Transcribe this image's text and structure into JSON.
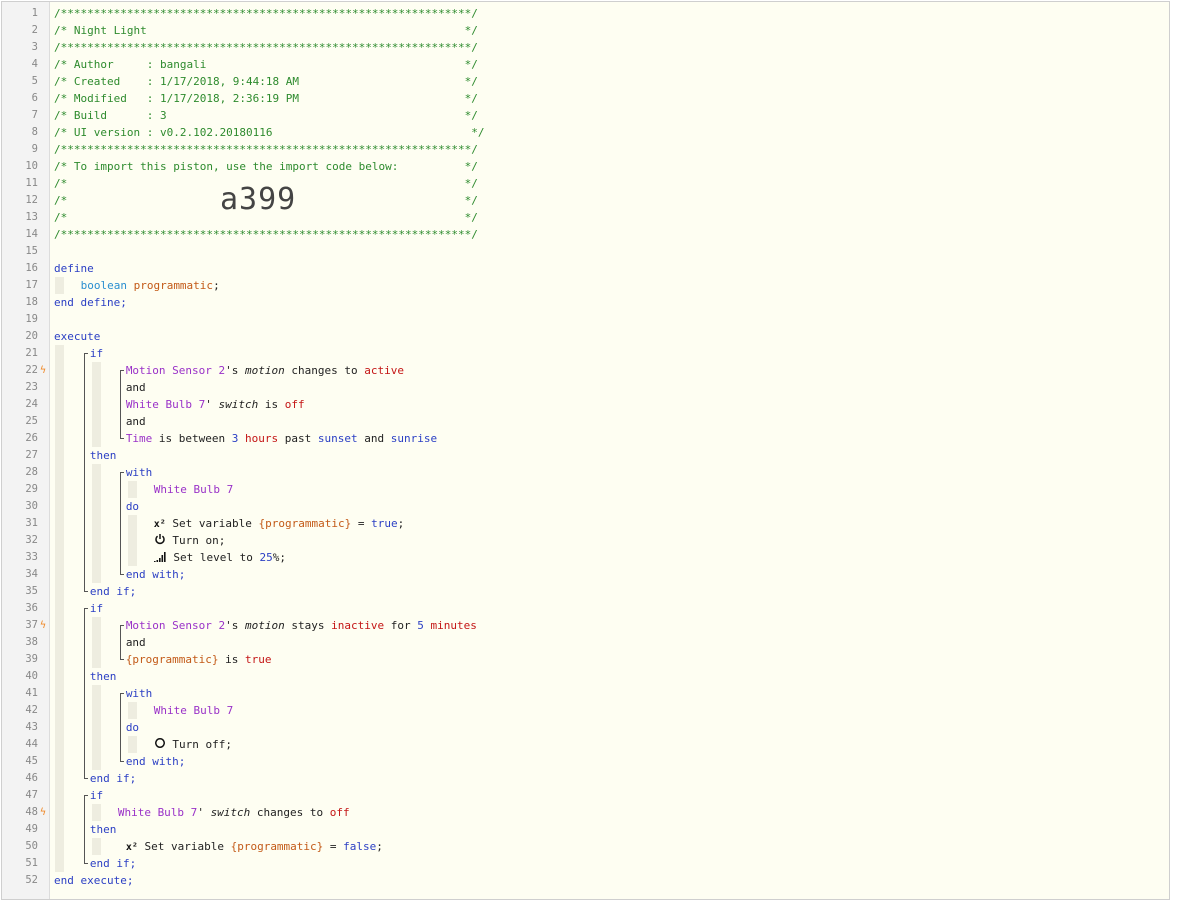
{
  "header": {
    "border": "/**************************************************************/",
    "title": "/* Night Light                                                */",
    "author": "/* Author     : bangali                                       */",
    "created": "/* Created    : 1/17/2018, 9:44:18 AM                         */",
    "modified": "/* Modified   : 1/17/2018, 2:36:19 PM                         */",
    "build": "/* Build      : 3                                             */",
    "ui_version": "/* UI version : v0.2.102.20180116                              */",
    "import_note": "/* To import this piston, use the import code below:          */",
    "blank": "/*                                                            */",
    "import_code": "a399"
  },
  "define": {
    "open": "define",
    "type": "boolean",
    "var": "programmatic",
    "semi": ";",
    "close": "end define;"
  },
  "keywords": {
    "execute": "execute",
    "if": "if",
    "then": "then",
    "and": "and",
    "with": "with",
    "do": "do",
    "end_with": "end with;",
    "end_if": "end if;",
    "end_execute": "end execute;"
  },
  "if1": {
    "c1_device": "Motion Sensor 2",
    "c1_possess": "'s ",
    "c1_attr": "motion",
    "c1_op": " changes to ",
    "c1_val": "active",
    "c2_device": "White Bulb 7",
    "c2_possess": "' ",
    "c2_attr": "switch",
    "c2_op": " is ",
    "c2_val": "off",
    "c3_time": "Time",
    "c3_op": " is between ",
    "c3_num": "3",
    "c3_unit": " hours",
    "c3_past": " past ",
    "c3_sunset": "sunset",
    "c3_and": " and ",
    "c3_sunrise": "sunrise",
    "with_device": "White Bulb 7",
    "a1_label": " Set variable ",
    "a1_var": "{programmatic}",
    "a1_eq": " = ",
    "a1_val": "true",
    "a1_semi": ";",
    "a2_label": " Turn on;",
    "a3_label": " Set level to ",
    "a3_num": "25",
    "a3_rest": "%;"
  },
  "if2": {
    "c1_device": "Motion Sensor 2",
    "c1_possess": "'s ",
    "c1_attr": "motion",
    "c1_op": " stays ",
    "c1_val": "inactive",
    "c1_for": " for ",
    "c1_num": "5",
    "c1_unit": " minutes",
    "c2_var": "{programmatic}",
    "c2_op": " is ",
    "c2_val": "true",
    "with_device": "White Bulb 7",
    "a1_label": " Turn off;"
  },
  "if3": {
    "c1_device": "White Bulb 7",
    "c1_possess": "' ",
    "c1_attr": "switch",
    "c1_op": " changes to ",
    "c1_val": "off",
    "a1_label": " Set variable ",
    "a1_var": "{programmatic}",
    "a1_eq": " = ",
    "a1_val": "false",
    "a1_semi": ";"
  },
  "icons": {
    "variable": "x²",
    "trigger": "lightning-bolt-icon",
    "power": "power-icon",
    "level": "signal-level-icon",
    "off": "power-off-icon"
  },
  "colors": {
    "background": "#fefef2",
    "comment": "#2e8b2e",
    "keyword": "#2b3fc4",
    "device": "#9a32c8",
    "variable": "#c35a18",
    "value": "#c41616",
    "trigger": "#f08a2a"
  }
}
